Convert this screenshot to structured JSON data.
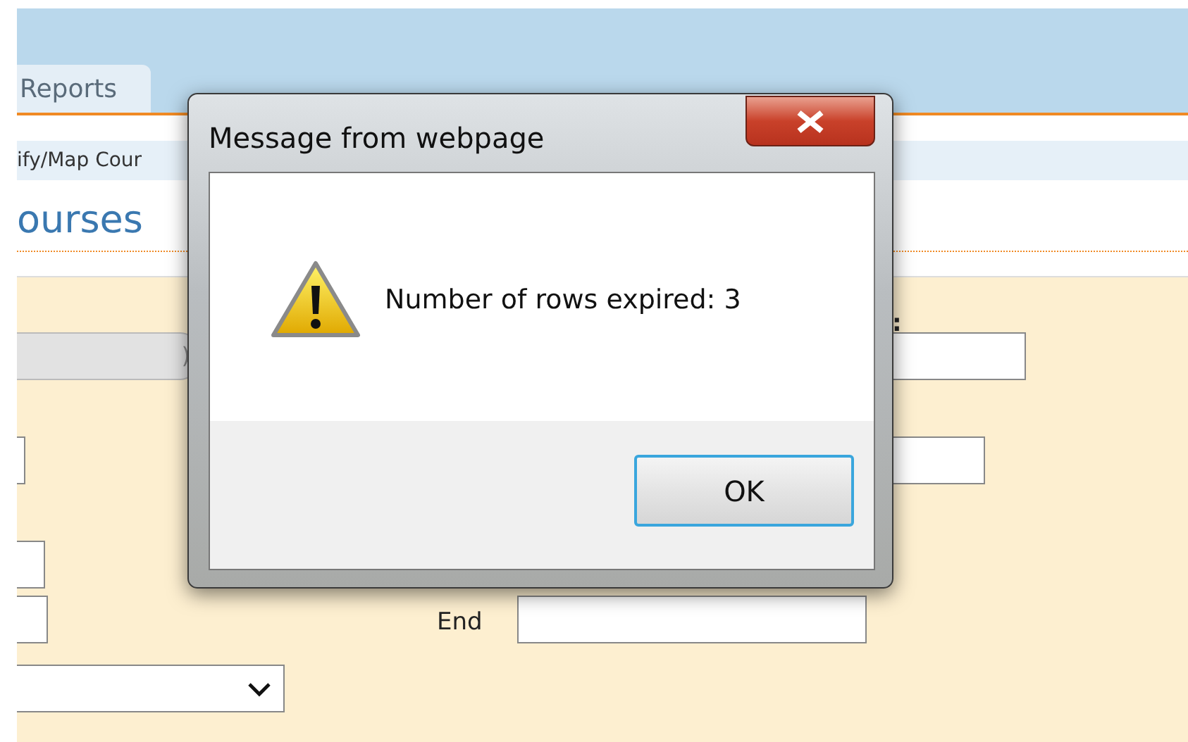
{
  "header": {
    "tabs": [
      {
        "label": "Reports",
        "selected": true
      }
    ]
  },
  "breadcrumb": "ify/Map Cour",
  "page_title": "ourses",
  "form": {
    "label_cut": ":",
    "disabled_field": {
      "value": ")",
      "disabled": true
    },
    "end_label": "End"
  },
  "dialog": {
    "title": "Message from webpage",
    "message": "Number of rows expired: 3",
    "buttons": [
      {
        "label": "OK",
        "selected": true
      }
    ]
  }
}
